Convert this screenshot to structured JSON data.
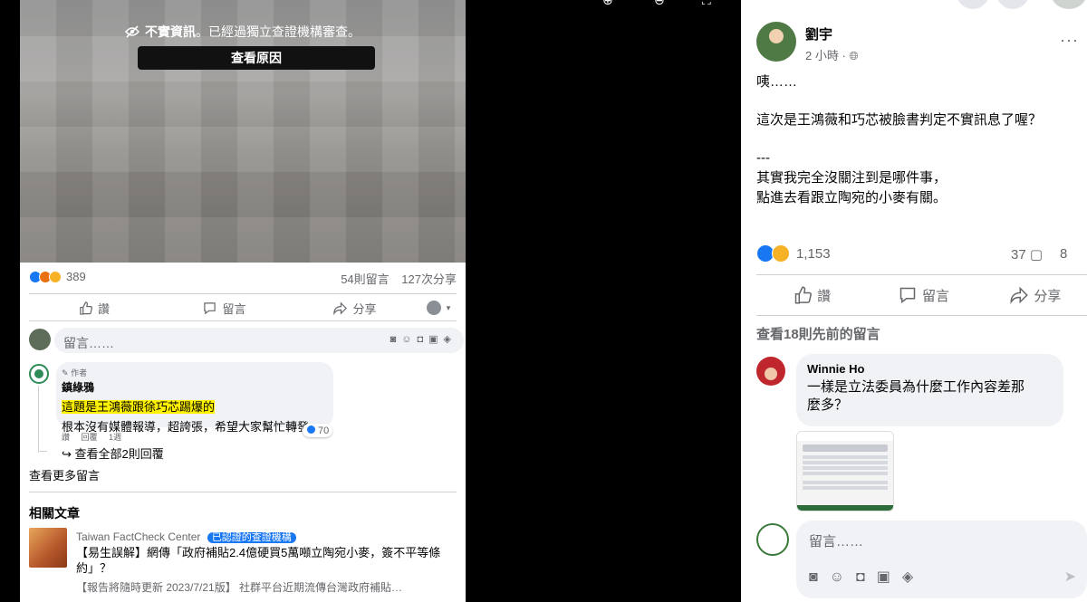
{
  "viewer": {
    "notice_bold": "不實資訊",
    "notice_text": "。已經過獨立查證機構審查。",
    "see_reason_label": "查看原因"
  },
  "left_post": {
    "reaction_count": "389",
    "comments_count": "54則留言",
    "shares_count": "127次分享",
    "like_label": "讚",
    "comment_label": "留言",
    "share_label": "分享",
    "comment_placeholder": "留言……",
    "comment": {
      "badge": "作者",
      "author": "鎮綠鴉",
      "highlight_text": "這題是王鴻薇跟徐巧芯踢爆的",
      "body_text": "根本沒有媒體報導，超誇張，希望大家幫忙轉發",
      "likes": "70",
      "like_action": "讚",
      "reply_action": "回覆",
      "time": "1週"
    },
    "view_replies_label": "查看全部2則回覆",
    "view_more_comments": "查看更多留言",
    "related_title": "相關文章",
    "related": {
      "source": "Taiwan FactCheck Center",
      "badge": "已認證的查證機構",
      "headline": "【易生誤解】網傳「政府補貼2.4億硬買5萬噸立陶宛小麥，簽不平等條約」？",
      "snippet": "【報告將隨時更新 2023/7/21版】 社群平台近期流傳台灣政府補貼…"
    }
  },
  "right_post": {
    "author": "劉宇",
    "time": "2 小時",
    "line1": "咦……",
    "line2": "這次是王鴻薇和巧芯被臉書判定不實訊息了喔？",
    "line3": "---",
    "line4": "其實我完全沒關注到是哪件事，",
    "line5": "點進去看跟立陶宛的小麥有關。",
    "reaction_count": "1,153",
    "comment_count": "37",
    "share_count": "8",
    "like_label": "讚",
    "comment_label": "留言",
    "share_label": "分享",
    "view_previous": "查看18則先前的留言",
    "comment": {
      "author": "Winnie Ho",
      "text_line1": "一樣是立法委員為什麼工作內容差那",
      "text_line2": "麼多？"
    },
    "comment_placeholder": "留言……"
  },
  "colors": {
    "fb_blue": "#1877f2",
    "highlight": "#fff200",
    "muted": "#65676b",
    "bubble": "#f0f2f5"
  }
}
